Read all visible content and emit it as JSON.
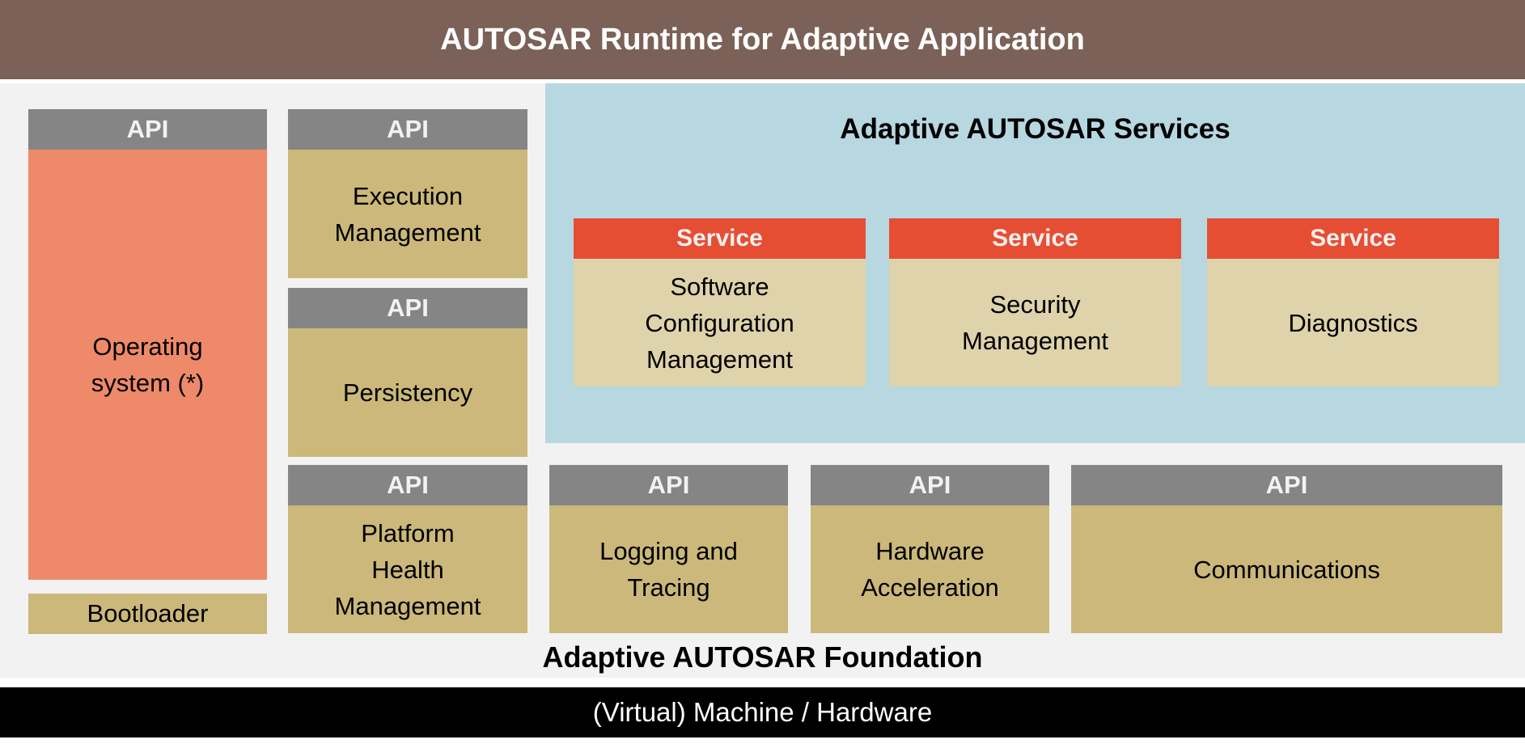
{
  "header": {
    "title": "AUTOSAR Runtime for Adaptive Application"
  },
  "api_label": "API",
  "service_label": "Service",
  "foundation": {
    "title": "Adaptive AUTOSAR Foundation",
    "operating_system": "Operating\nsystem (*)",
    "bootloader": "Bootloader",
    "execution_management": "Execution\nManagement",
    "persistency": "Persistency",
    "platform_health_management": "Platform\nHealth\nManagement",
    "logging_and_tracing": "Logging and\nTracing",
    "hardware_acceleration": "Hardware\nAcceleration",
    "communications": "Communications"
  },
  "services": {
    "title": "Adaptive AUTOSAR Services",
    "items": [
      {
        "label": "Software\nConfiguration\nManagement"
      },
      {
        "label": "Security\nManagement"
      },
      {
        "label": "Diagnostics"
      }
    ]
  },
  "hardware": {
    "label": "(Virtual) Machine / Hardware"
  },
  "colors": {
    "header": "#7B6157",
    "api_header": "#858585",
    "service_header": "#E64E34",
    "module": "#CBB87A",
    "service_module": "#DED3AA",
    "operating_system": "#EE8A69",
    "services_background": "#B7D7E1",
    "hardware_bar": "#000000"
  }
}
